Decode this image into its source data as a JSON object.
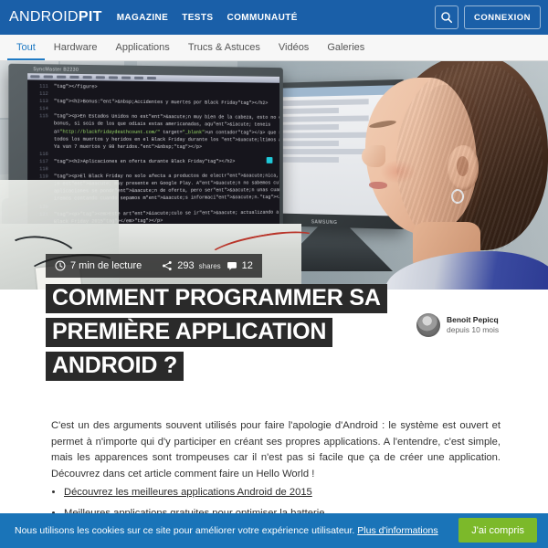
{
  "header": {
    "logo_light": "ANDROID",
    "logo_bold": "PIT",
    "nav": [
      {
        "label": "MAGAZINE"
      },
      {
        "label": "TESTS"
      },
      {
        "label": "COMMUNAUTÉ"
      }
    ],
    "search_icon": "search-icon",
    "login_label": "CONNEXION",
    "bg_color": "#1a5fa8"
  },
  "subnav": {
    "items": [
      {
        "label": "Tout",
        "active": true
      },
      {
        "label": "Hardware",
        "active": false
      },
      {
        "label": "Applications",
        "active": false
      },
      {
        "label": "Trucs & Astuces",
        "active": false
      },
      {
        "label": "Vidéos",
        "active": false
      },
      {
        "label": "Galeries",
        "active": false
      }
    ],
    "active_color": "#1f7ac4"
  },
  "hero": {
    "monitor_brand_1": "SyncMaster B2230",
    "monitor_brand_2": "SAMSUNG",
    "code_lines": [
      {
        "num": "111",
        "text": "</figure>"
      },
      {
        "num": "112",
        "text": ""
      },
      {
        "num": "113",
        "text": "<h2>Bonus:&nbsp;Accidentes y muertes por Black Friday</h2>"
      },
      {
        "num": "114",
        "text": ""
      },
      {
        "num": "115",
        "text": "<p>En Estados Unidos no est&aacute;n muy bien de la cabeza, esto no es novedad. Como"
      },
      {
        "num": "",
        "text": "bonus, si sois de los que odiais estas americanadas, aqu&iacute; teneis"
      },
      {
        "num": "",
        "text": "a=\"http://blackfridaydeathcount.com/\" target=\"_blank\">un contador</a> que registra"
      },
      {
        "num": "",
        "text": "todos los muertos y heridos en el Black Friday durante los &uacute;ltimos a&ntilde;os."
      },
      {
        "num": "",
        "text": "Ya van 7 muertos y 98 heridos.&nbsp;</p>"
      },
      {
        "num": "116",
        "text": ""
      },
      {
        "num": "117",
        "text": "<h2>Aplicaciones en oferta durante Black Friday</h2>"
      },
      {
        "num": "118",
        "text": ""
      },
      {
        "num": "119",
        "text": "<p>El Black Friday no solo afecta a productos de electr&oacute;nica, sino tambi&eacute;n"
      },
      {
        "num": "",
        "text": ";n est&aacute; muy presente en Google Play. A&uacute;n no sabemos cu&aacute;ntas"
      },
      {
        "num": "",
        "text": "aplicaciones se pondr&aacute;n de oferta, pero ser&aacute;n unas cuantas, as&iacute;"
      },
      {
        "num": "",
        "text": "iremos contando cuando sepamos m&aacute;s informaci&oacute;n.</p>"
      },
      {
        "num": "120",
        "text": ""
      },
      {
        "num": "121",
        "text": "<p><em>Este art&iacute;culo se ir&aacute; actualizando a medida que se acerque el"
      },
      {
        "num": "",
        "text": "Black Friday 2015</em></p>"
      },
      {
        "num": "122",
        "text": ""
      }
    ]
  },
  "meta": {
    "clock_icon": "clock-icon",
    "reading_time": "7 min de lecture",
    "share_icon": "share-icon",
    "share_count": "293",
    "share_label": "shares",
    "comment_icon": "comment-icon",
    "comment_count": "12"
  },
  "article": {
    "title": "COMMENT PROGRAMMER SA PREMIÈRE APPLICATION ANDROID ?",
    "author_name": "Benoit Pepicq",
    "author_since": "depuis 10 mois",
    "intro": "C'est un des arguments souvent utilisés pour faire l'apologie d'Android : le système est ouvert et permet à n'importe qui d'y participer en créant ses propres applications. A l'entendre, c'est simple, mais les apparences sont trompeuses car il n'est pas si facile que ça de créer une application. Découvrez dans cet article comment faire un Hello World !",
    "links": [
      {
        "label": "Découvrez les meilleures applications Android de 2015"
      },
      {
        "label": "Meilleures applications gratuites pour optimiser la batterie"
      }
    ]
  },
  "cookie": {
    "message": "Nous utilisons les cookies sur ce site pour améliorer votre expérience utilisateur.",
    "more_label": "Plus d'informations",
    "accept_label": "J'ai compris",
    "bg_color": "#1a74b8",
    "button_color": "#7cb92a"
  }
}
